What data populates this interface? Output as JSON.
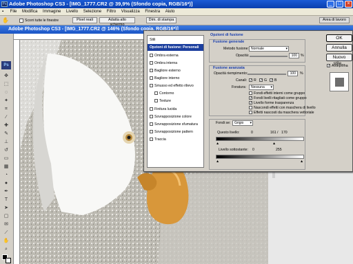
{
  "window": {
    "title": "Adobe Photoshop CS3 - [IMG_1777.CR2 @ 39,9% (Sfondo copia, RGB/16*)]",
    "minimize": "_",
    "maximize": "□",
    "close": "×"
  },
  "menu": [
    "File",
    "Modifica",
    "Immagine",
    "Livello",
    "Selezione",
    "Filtro",
    "Visualizza",
    "Finestra",
    "Aiuto"
  ],
  "options": {
    "scroll_all_windows": "Scorri tutte le finestre",
    "actual_pixels": "Pixel reali",
    "fit_screen": "Adatta allo schermo",
    "print_size": "Dim. di stampa",
    "workspace": "Area di lavoro"
  },
  "document": {
    "title": "Adobe Photoshop CS3 - [IMG_1777.CR2 @ 146% (Sfondo copia, RGB/16*)]",
    "file_menu": [
      "File",
      "Modifica",
      "Immagine"
    ],
    "scroll_all_windows": "Scorri tutte le finestre",
    "actual_pixels": "Pixel reali",
    "fit_screen": "Adatta allo schermo",
    "print_size": "Dim. di stampa"
  },
  "dialog": {
    "styles": [
      {
        "label": "Stili",
        "type": "plain",
        "active": false,
        "checked": false
      },
      {
        "label": "Opzioni di fusione: Personali",
        "type": "header",
        "active": true,
        "checked": false
      },
      {
        "label": "Ombra esterna",
        "type": "check",
        "checked": false,
        "indent": false
      },
      {
        "label": "Ombra interna",
        "type": "check",
        "checked": false,
        "indent": false
      },
      {
        "label": "Bagliore esterno",
        "type": "check",
        "checked": false,
        "indent": false
      },
      {
        "label": "Bagliore interno",
        "type": "check",
        "checked": false,
        "indent": false
      },
      {
        "label": "Smusso ed effetto rilievo",
        "type": "check",
        "checked": false,
        "indent": false
      },
      {
        "label": "Contorno",
        "type": "check",
        "checked": false,
        "indent": true
      },
      {
        "label": "Texture",
        "type": "check",
        "checked": false,
        "indent": true
      },
      {
        "label": "Finitura lucida",
        "type": "check",
        "checked": false,
        "indent": false
      },
      {
        "label": "Sovrapposizione colore",
        "type": "check",
        "checked": false,
        "indent": false
      },
      {
        "label": "Sovrapposizione sfumatura",
        "type": "check",
        "checked": false,
        "indent": false
      },
      {
        "label": "Sovrapposizione pattern",
        "type": "check",
        "checked": false,
        "indent": false
      },
      {
        "label": "Traccia",
        "type": "check",
        "checked": false,
        "indent": false
      }
    ],
    "blend_options_title": "Opzioni di fusione",
    "general_title": "Fusione generale",
    "blend_mode_label": "Metodo fusione:",
    "blend_mode_value": "Normale",
    "opacity_label": "Opacità:",
    "opacity_value": "100",
    "percent": "%",
    "advanced_title": "Fusione avanzata",
    "fill_opacity_label": "Opacità riempimento:",
    "fill_opacity_value": "100",
    "channels_label": "Canali:",
    "channel_r": "R",
    "channel_g": "G",
    "channel_b": "B",
    "knockout_label": "Foratura:",
    "knockout_value": "Nessuna",
    "adv_options": [
      {
        "label": "Fondi effetti interni come gruppo",
        "checked": false
      },
      {
        "label": "Fondi livelli ritagliati come gruppo",
        "checked": true
      },
      {
        "label": "Livello forme trasparenza",
        "checked": true
      },
      {
        "label": "Nascondi effetti con maschera di livello",
        "checked": false
      },
      {
        "label": "Effetti nascosti da maschera vettoriale",
        "checked": false
      }
    ],
    "blend_if_label": "Fondi se:",
    "blend_if_value": "Grigio",
    "this_layer_label": "Questo livello:",
    "this_layer_values": [
      "0",
      "161",
      "/",
      "170"
    ],
    "underlying_label": "Livello sottostante:",
    "underlying_values": [
      "0",
      "255"
    ],
    "ok": "OK",
    "cancel": "Annulla",
    "new_style": "Nuovo stile...",
    "preview": "Anteprima"
  }
}
